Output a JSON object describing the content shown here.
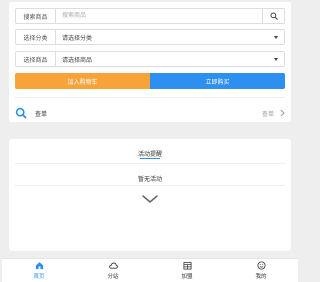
{
  "form": {
    "search": {
      "label": "搜索商品",
      "placeholder": "搜索商品",
      "value": ""
    },
    "category": {
      "label": "选择分类",
      "value": "请选择分类"
    },
    "product": {
      "label": "选择商品",
      "value": "请选择商品"
    },
    "actions": {
      "add_to_cart": "加入购物车",
      "buy_now": "立即购买"
    },
    "query": {
      "label": "查单",
      "value": "查单"
    }
  },
  "activity": {
    "title": "活动提醒",
    "empty_text": "暂无活动"
  },
  "tabbar": {
    "items": [
      {
        "label": "首页",
        "icon": "home-icon",
        "active": true
      },
      {
        "label": "分站",
        "icon": "cloud-icon",
        "active": false
      },
      {
        "label": "加盟",
        "icon": "calendar-icon",
        "active": false
      },
      {
        "label": "我的",
        "icon": "smile-icon",
        "active": false
      }
    ]
  },
  "colors": {
    "accent": "#2d8ff0",
    "orange": "#f8a33a",
    "background": "#eeeeee"
  }
}
